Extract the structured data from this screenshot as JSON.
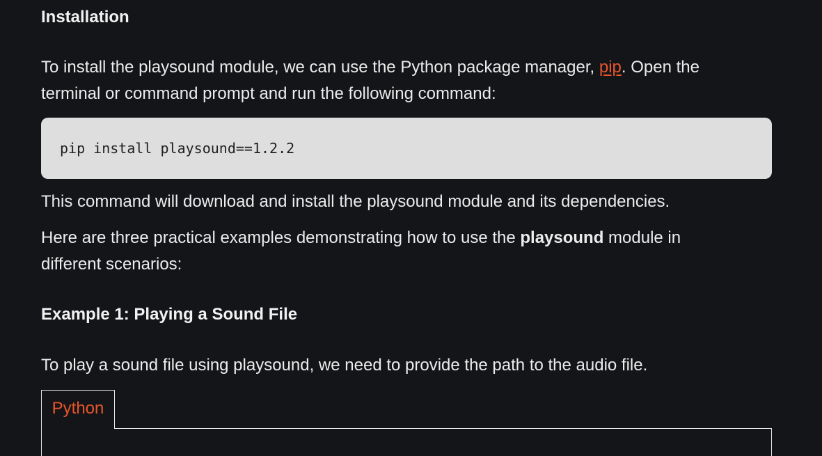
{
  "installation": {
    "heading": "Installation",
    "intro_before": "To install the playsound module, we can use the Python package manager, ",
    "intro_link": "pip",
    "intro_after": ". Open the terminal or command prompt and run the following command:",
    "command": "pip install playsound==1.2.2",
    "after_command": "This command will download and install the playsound module and its dependencies.",
    "examples_before": "Here are three practical examples demonstrating how to use the ",
    "examples_bold": "playsound",
    "examples_after": " module in different scenarios:"
  },
  "example1": {
    "heading": "Example 1: Playing a Sound File",
    "description": "To play a sound file using playsound, we need to provide the path to the audio file.",
    "tab_label": "Python"
  },
  "colors": {
    "background": "#141518",
    "text": "#ececed",
    "link": "#e8552b",
    "code_background": "#dedede"
  }
}
